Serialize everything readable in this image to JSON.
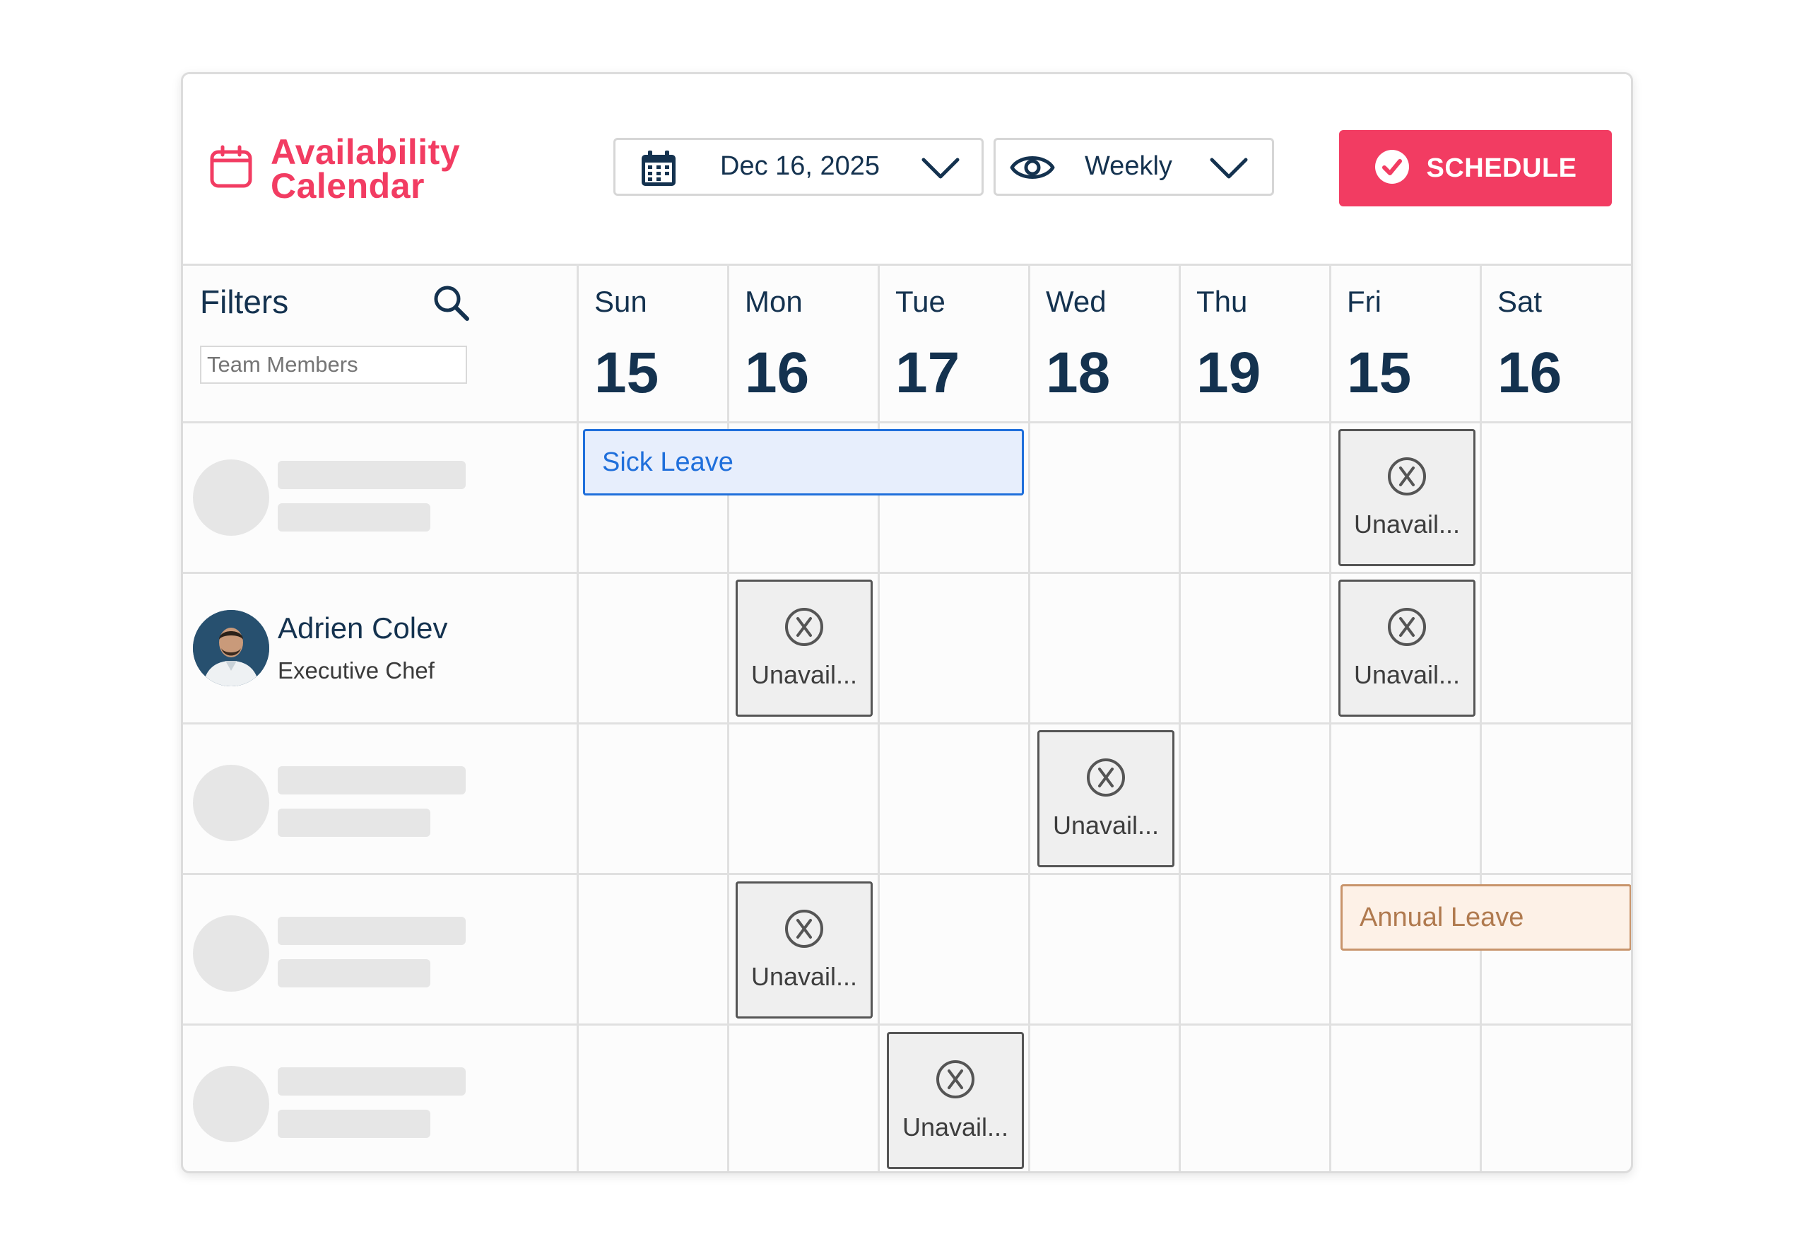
{
  "app": {
    "title": "Availability Calendar",
    "title_line1": "Availability",
    "title_line2": "Calendar",
    "accent_color": "#f23c62",
    "icon": "calendar-icon"
  },
  "toolbar": {
    "date_value": "Dec 16, 2025",
    "date_icon": "calendar-grid-icon",
    "view_value": "Weekly",
    "view_icon": "eye-icon",
    "schedule_label": "SCHEDULE",
    "schedule_icon": "check-circle-icon"
  },
  "filters": {
    "label": "Filters",
    "search_icon": "search-icon",
    "team_placeholder": "Team Members"
  },
  "days": [
    {
      "name": "Sun",
      "num": "15"
    },
    {
      "name": "Mon",
      "num": "16"
    },
    {
      "name": "Tue",
      "num": "17"
    },
    {
      "name": "Wed",
      "num": "18"
    },
    {
      "name": "Thu",
      "num": "19"
    },
    {
      "name": "Fri",
      "num": "15"
    },
    {
      "name": "Sat",
      "num": "16"
    }
  ],
  "member": {
    "name": "Adrien Colev",
    "role": "Executive Chef"
  },
  "events": {
    "sick_leave": "Sick Leave",
    "annual_leave": "Annual Leave",
    "unavailable": "Unavail..."
  },
  "colors": {
    "sick_leave": "#1f6fdb",
    "annual_leave": "#c8946b",
    "text_primary": "#14324f"
  }
}
